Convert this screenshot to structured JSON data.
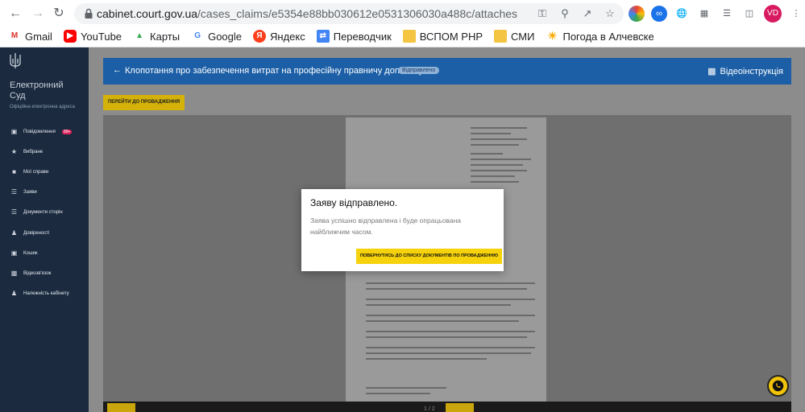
{
  "browser": {
    "url_host": "cabinet.court.gov.ua",
    "url_path": "/cases_claims/e5354e88bb030612e0531306030a488c/attaches",
    "profile_initials": "VD",
    "bookmarks": [
      {
        "label": "Gmail",
        "icon": "gmail-icon",
        "color": "#d93025"
      },
      {
        "label": "YouTube",
        "icon": "youtube-icon",
        "color": "#ff0000"
      },
      {
        "label": "Карты",
        "icon": "maps-icon",
        "color": "#34a853"
      },
      {
        "label": "Google",
        "icon": "google-icon",
        "color": "#4285f4"
      },
      {
        "label": "Яндекс",
        "icon": "yandex-icon",
        "color": "#fc3f1d"
      },
      {
        "label": "Переводчик",
        "icon": "translate-icon",
        "color": "#4285f4"
      },
      {
        "label": "ВСПОМ РНР",
        "icon": "folder-icon",
        "color": "#f4c542"
      },
      {
        "label": "СМИ",
        "icon": "folder-icon",
        "color": "#f4c542"
      },
      {
        "label": "Погода в Алчевске",
        "icon": "sun-icon",
        "color": "#f9ab00"
      }
    ]
  },
  "sidebar": {
    "brand": "Електронний Суд",
    "brand_sub": "Офіційна електронна адреса",
    "items": [
      {
        "label": "Повідомлення",
        "icon": "message-icon",
        "badge": "99+"
      },
      {
        "label": "Вибране",
        "icon": "star-icon"
      },
      {
        "label": "Мої справи",
        "icon": "folder-icon"
      },
      {
        "label": "Заяви",
        "icon": "list-icon"
      },
      {
        "label": "Документи сторін",
        "icon": "documents-icon"
      },
      {
        "label": "Довіреності",
        "icon": "users-icon"
      },
      {
        "label": "Кошик",
        "icon": "wallet-icon"
      },
      {
        "label": "Відеозв'язок",
        "icon": "video-icon"
      },
      {
        "label": "Належність кабінету",
        "icon": "person-icon"
      }
    ]
  },
  "header": {
    "title": "Клопотання про забезпечення витрат на професійну правничу допомогу",
    "status": "Відправлено",
    "video_label": "Відеоінструкція"
  },
  "go_button": "ПЕРЕЙТИ ДО ПРОВАДЖЕННЯ",
  "modal": {
    "title": "Заяву відправлено.",
    "text": "Заява успішно відправлена і буде опрацьована найближчим часом.",
    "button": "ПОВЕРНУТИСЬ ДО СПИСКУ ДОКУМЕНТІВ ПО ПРОВАДЖЕННЮ"
  },
  "viewer": {
    "page_indicator": "1 / 2"
  },
  "colors": {
    "sidebar": "#1b2a3f",
    "header": "#1c5fa6",
    "accent": "#f5d20b",
    "badge": "#e0245e"
  }
}
